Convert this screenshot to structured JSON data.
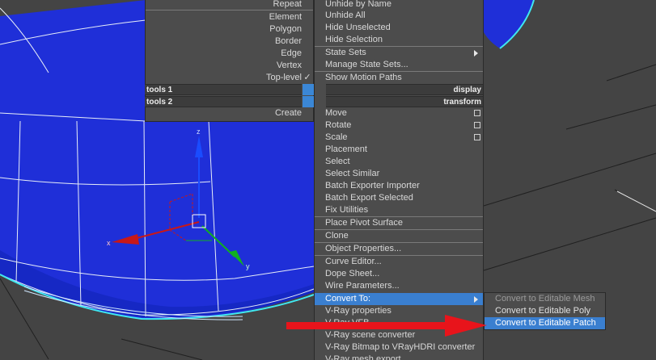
{
  "scene": {
    "axis_labels": {
      "z": "z",
      "x": "x",
      "y": "y"
    },
    "colors": {
      "background": "#444444",
      "sphere": "#1f2fd8",
      "wire": "#e8eef8",
      "selection": "#40e8f0",
      "arrow": "#e8141b"
    }
  },
  "quad_menu_left": {
    "items": [
      "Repeat",
      "Element",
      "Polygon",
      "Border",
      "Edge",
      "Vertex",
      "Top-level",
      "Create"
    ],
    "checked_item": "Top-level",
    "check_glyph": "✓",
    "header_1": "tools 1",
    "header_2": "tools 2"
  },
  "quad_menu_right": {
    "display_items": [
      "Unhide by Name",
      "Unhide All",
      "Hide Unselected",
      "Hide Selection",
      "State Sets",
      "Manage State Sets...",
      "Show Motion Paths"
    ],
    "header_1": "display",
    "header_2": "transform",
    "transform_items": [
      "Move",
      "Rotate",
      "Scale",
      "Placement",
      "Select",
      "Select Similar",
      "Batch Exporter Importer",
      "Batch Export Selected",
      "Fix Utilities",
      "Place Pivot Surface",
      "Clone",
      "Object Properties...",
      "Curve Editor...",
      "Dope Sheet...",
      "Wire Parameters...",
      "Convert To:",
      "V-Ray properties",
      "V-Ray VFB",
      "V-Ray scene converter",
      "V-Ray Bitmap to VRayHDRI converter",
      "V-Ray mesh export"
    ]
  },
  "convert_submenu": {
    "items": [
      "Convert to Editable Mesh",
      "Convert to Editable Poly",
      "Convert to Editable Patch"
    ],
    "highlighted": "Convert to Editable Patch"
  },
  "highlight_color": "#3a7fd0"
}
